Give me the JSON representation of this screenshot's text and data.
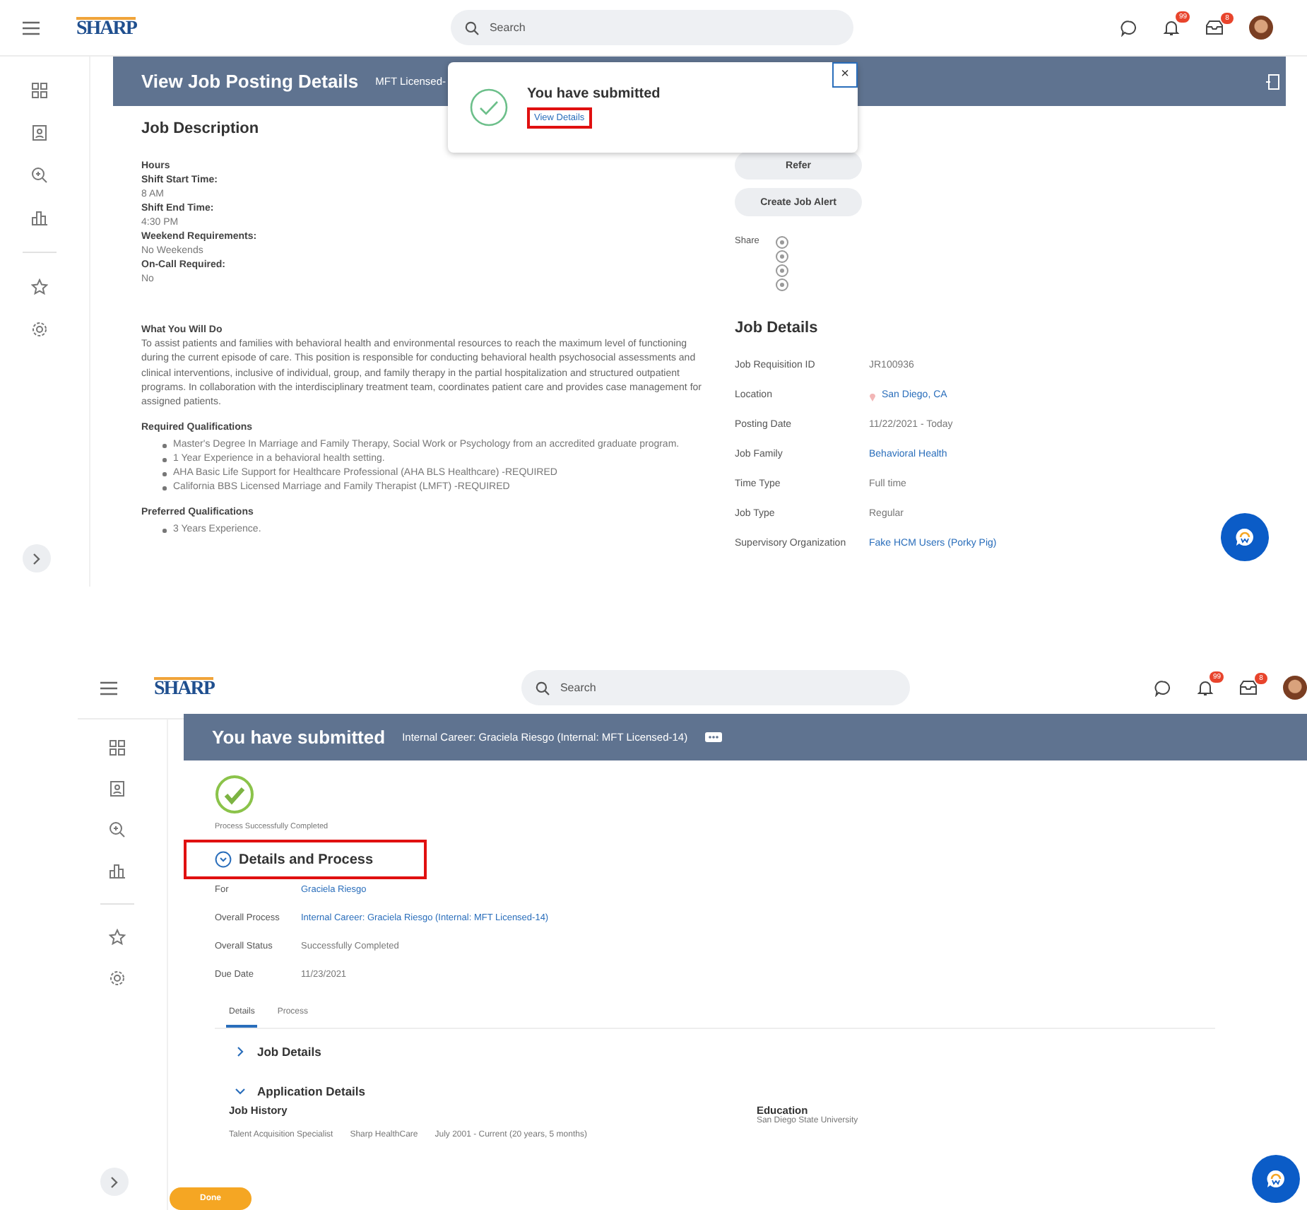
{
  "job_posting": {
    "topbar": {
      "logo": "SHARP",
      "search_placeholder": "Search",
      "notification_badge": "99",
      "inbox_badge": "8"
    },
    "header": {
      "title": "View Job Posting Details",
      "subtitle": "MFT Licensed-"
    },
    "popup": {
      "title": "You have submitted",
      "link": "View Details",
      "highlighted": true,
      "close": "×"
    },
    "job_description": {
      "heading": "Job Description",
      "lines": [
        {
          "kind": "label",
          "text": "Hours"
        },
        {
          "kind": "label",
          "text": "Shift Start Time:"
        },
        {
          "kind": "value",
          "text": "8 AM"
        },
        {
          "kind": "label",
          "text": "Shift End Time:"
        },
        {
          "kind": "value",
          "text": "4:30 PM"
        },
        {
          "kind": "label",
          "text": "Weekend Requirements:"
        },
        {
          "kind": "value",
          "text": "No Weekends"
        },
        {
          "kind": "label",
          "text": "On-Call Required:"
        },
        {
          "kind": "value",
          "text": "No"
        }
      ]
    },
    "what_you_will_do": {
      "heading": "What You Will Do",
      "text": "To assist patients and families with behavioral health and environmental resources to reach the maximum level of functioning during the current episode of care. This position is responsible for conducting behavioral health psychosocial assessments and clinical interventions, inclusive of individual, group, and family therapy in the partial hospitalization and structured outpatient programs. In collaboration with the interdisciplinary treatment team, coordinates patient care and provides case management for assigned patients."
    },
    "required_qualifications": {
      "heading": "Required Qualifications",
      "items": [
        "Master's Degree In Marriage and Family Therapy, Social Work or Psychology from an accredited graduate program.",
        "1 Year Experience in a behavioral health setting.",
        "AHA Basic Life Support for Healthcare Professional (AHA BLS Healthcare) -REQUIRED",
        "California BBS Licensed Marriage and Family Therapist (LMFT) -REQUIRED"
      ]
    },
    "preferred_qualifications": {
      "heading": "Preferred Qualifications",
      "items": [
        "3 Years Experience."
      ]
    },
    "actions": [
      "Refer",
      "Create Job Alert"
    ],
    "share": {
      "label": "Share"
    },
    "job_details": {
      "heading": "Job Details",
      "rows": [
        {
          "label": "Job Requisition ID",
          "value": "JR100936",
          "kind": "text"
        },
        {
          "label": "Location",
          "value": "San Diego, CA",
          "kind": "location"
        },
        {
          "label": "Posting Date",
          "value": "11/22/2021 - Today",
          "kind": "text"
        },
        {
          "label": "Job Family",
          "value": "Behavioral Health",
          "kind": "link"
        },
        {
          "label": "Time Type",
          "value": "Full time",
          "kind": "text"
        },
        {
          "label": "Job Type",
          "value": "Regular",
          "kind": "text"
        },
        {
          "label": "Supervisory Organization",
          "value": "Fake HCM Users (Porky Pig)",
          "kind": "link"
        }
      ]
    }
  },
  "submitted": {
    "topbar": {
      "logo": "SHARP",
      "search_placeholder": "Search",
      "notification_badge": "99",
      "inbox_badge": "8"
    },
    "header": {
      "title": "You have submitted",
      "subtitle": "Internal Career: Graciela Riesgo (Internal: MFT Licensed-14)"
    },
    "status": "Process Successfully Completed",
    "details_heading": {
      "text": "Details and Process",
      "highlighted": true
    },
    "fields": [
      {
        "label": "For",
        "value": "Graciela Riesgo",
        "kind": "link"
      },
      {
        "label": "Overall Process",
        "value": "Internal Career: Graciela Riesgo (Internal: MFT Licensed-14)",
        "kind": "link"
      },
      {
        "label": "Overall Status",
        "value": "Successfully Completed",
        "kind": "text"
      },
      {
        "label": "Due Date",
        "value": "11/23/2021",
        "kind": "text"
      }
    ],
    "tabs": [
      {
        "label": "Details",
        "selected": true
      },
      {
        "label": "Process",
        "selected": false
      }
    ],
    "sections": [
      {
        "title": "Job Details",
        "expanded": false
      },
      {
        "title": "Application Details",
        "expanded": true
      }
    ],
    "job_history": {
      "heading": "Job History",
      "cells": [
        "Talent Acquisition Specialist",
        "Sharp HealthCare",
        "July 2001 - Current (20 years, 5 months)"
      ]
    },
    "education": {
      "heading": "Education",
      "text": "San Diego State University"
    },
    "done_button": "Done"
  }
}
